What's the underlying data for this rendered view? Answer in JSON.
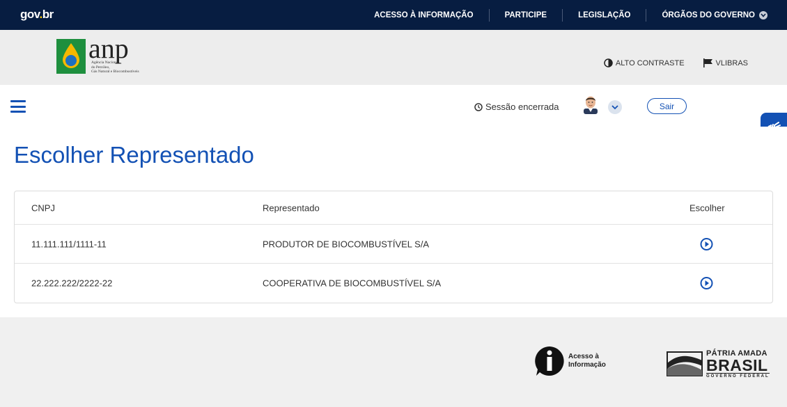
{
  "govbar": {
    "logo_prefix": "gov",
    "logo_dot": ".",
    "logo_suffix": "br",
    "nav": [
      "ACESSO À INFORMAÇÃO",
      "PARTICIPE",
      "LEGISLAÇÃO",
      "ÓRGÃOS DO GOVERNO"
    ]
  },
  "anp_header": {
    "logo_text": "anp",
    "logo_subtitle_1": "Agência Nacional",
    "logo_subtitle_2": "do Petróleo,",
    "logo_subtitle_3": "Gás Natural e Biocombustíveis",
    "alto_contraste": "ALTO CONTRASTE",
    "vlibras": "VLIBRAS"
  },
  "session": {
    "status": "Sessão encerrada",
    "sair_label": "Sair"
  },
  "page": {
    "title": "Escolher Representado"
  },
  "table": {
    "headers": [
      "CNPJ",
      "Representado",
      "Escolher"
    ],
    "rows": [
      {
        "cnpj": "11.111.111/1111-11",
        "representado": "PRODUTOR DE BIOCOMBUSTÍVEL S/A"
      },
      {
        "cnpj": "22.222.222/2222-22",
        "representado": "COOPERATIVA DE BIOCOMBUSTÍVEL S/A"
      }
    ]
  },
  "footer": {
    "acesso_line1": "Acesso à",
    "acesso_line2": "Informação",
    "patria_line1": "PÁTRIA AMADA",
    "patria_line2": "BRASIL",
    "patria_line3": "GOVERNO FEDERAL"
  },
  "icons": {
    "contrast": "contrast-icon",
    "vlibras": "flag-icon",
    "clock": "clock-icon",
    "play": "play-circle-icon",
    "hands": "sign-language-icon"
  },
  "colors": {
    "govbar_bg": "#071d41",
    "primary_blue": "#1351b4",
    "anp_green": "#1e8f3e"
  }
}
